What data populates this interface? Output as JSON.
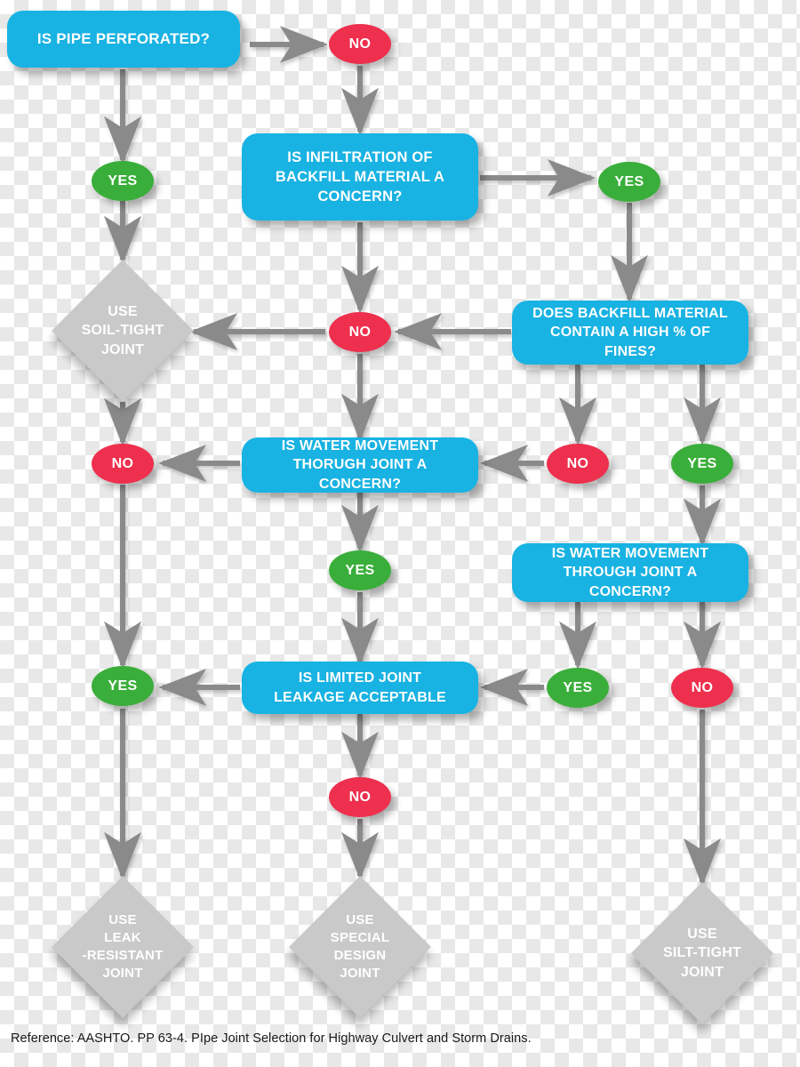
{
  "diagram": {
    "title": "Pipe Joint Selection for Highway Culvert and Storm Drains",
    "colors": {
      "question_box": "#18b3e3",
      "yes_pill": "#3aae3a",
      "no_pill": "#ee2f4d",
      "terminal_diamond": "#c9c9c9",
      "arrow": "#8a8a8a",
      "node_text": "#ffffff",
      "footer_text": "#1a1a1a"
    },
    "questions": {
      "q1": "IS PIPE PERFORATED?",
      "q2": "IS INFILTRATION OF\nBACKFILL MATERIAL A\nCONCERN?",
      "q3": "DOES BACKFILL MATERIAL\nCONTAIN A HIGH % OF\nFINES?",
      "q4": "IS WATER MOVEMENT\nTHORUGH JOINT A\nCONCERN?",
      "q5": "IS WATER MOVEMENT\nTHROUGH JOINT A\nCONCERN?",
      "q6": "IS LIMITED JOINT\nLEAKAGE ACCEPTABLE"
    },
    "answers": {
      "no": "NO",
      "yes": "YES"
    },
    "pills": {
      "p_q1_no": "NO",
      "p_q1_yes": "YES",
      "p_q2_yes": "YES",
      "p_q2_no": "NO",
      "p_q3_no": "NO",
      "p_q3_yes": "YES",
      "p_q4_no": "NO",
      "p_q4_yes": "YES",
      "p_q5_yes": "YES",
      "p_q5_no": "NO",
      "p_q6_yes": "YES",
      "p_q6_no": "NO"
    },
    "terminals": {
      "t_soil_tight": "USE\nSOIL-TIGHT\nJOINT",
      "t_leak_resistant": "USE\nLEAK\n-RESISTANT\nJOINT",
      "t_special_design": "USE\nSPECIAL\nDESIGN\nJOINT",
      "t_silt_tight": "USE\nSILT-TIGHT\nJOINT"
    },
    "footer": {
      "reference": "Reference: AASHTO. PP 63-4. PIpe Joint Selection for Highway Culvert and Storm Drains."
    }
  }
}
